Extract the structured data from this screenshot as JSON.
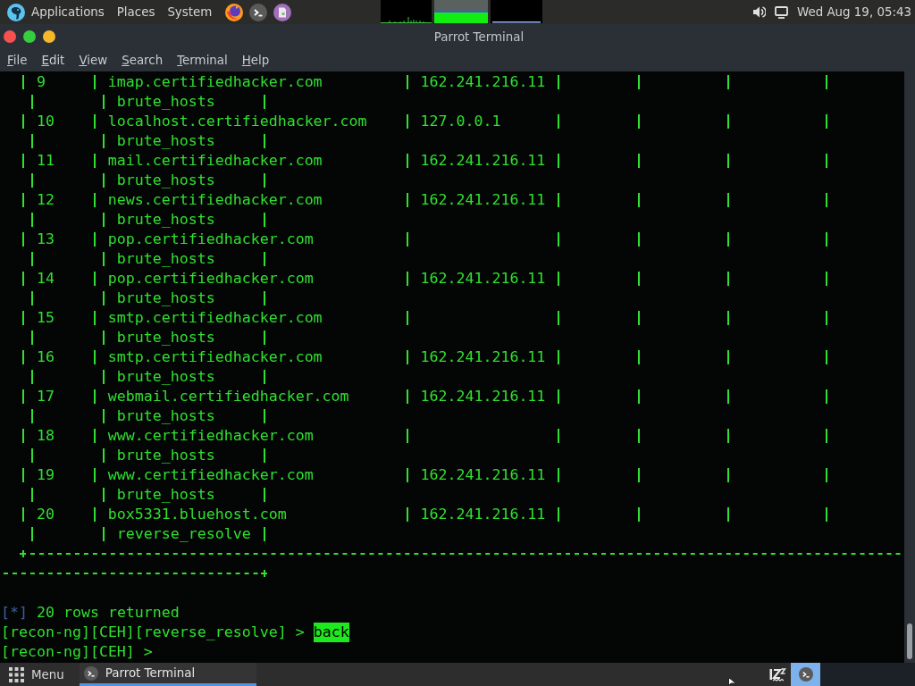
{
  "top_panel": {
    "menus": [
      "Applications",
      "Places",
      "System"
    ],
    "clock": "Wed Aug 19, 05:43"
  },
  "window": {
    "title": "Parrot Terminal",
    "menu": [
      "File",
      "Edit",
      "View",
      "Search",
      "Terminal",
      "Help"
    ]
  },
  "terminal": {
    "table": {
      "rows": [
        {
          "number": "9",
          "host": "imap.certifiedhacker.com",
          "ip": "162.241.216.11",
          "module": "brute_hosts"
        },
        {
          "number": "10",
          "host": "localhost.certifiedhacker.com",
          "ip": "127.0.0.1",
          "module": "brute_hosts"
        },
        {
          "number": "11",
          "host": "mail.certifiedhacker.com",
          "ip": "162.241.216.11",
          "module": "brute_hosts"
        },
        {
          "number": "12",
          "host": "news.certifiedhacker.com",
          "ip": "162.241.216.11",
          "module": "brute_hosts"
        },
        {
          "number": "13",
          "host": "pop.certifiedhacker.com",
          "module": "brute_hosts"
        },
        {
          "number": "14",
          "host": "pop.certifiedhacker.com",
          "ip": "162.241.216.11",
          "module": "brute_hosts"
        },
        {
          "number": "15",
          "host": "smtp.certifiedhacker.com",
          "module": "brute_hosts"
        },
        {
          "number": "16",
          "host": "smtp.certifiedhacker.com",
          "ip": "162.241.216.11",
          "module": "brute_hosts"
        },
        {
          "number": "17",
          "host": "webmail.certifiedhacker.com",
          "ip": "162.241.216.11",
          "module": "brute_hosts"
        },
        {
          "number": "18",
          "host": "www.certifiedhacker.com",
          "module": "brute_hosts"
        },
        {
          "number": "19",
          "host": "www.certifiedhacker.com",
          "ip": "162.241.216.11",
          "module": "brute_hosts"
        },
        {
          "number": "20",
          "host": "box5331.bluehost.com",
          "ip": "162.241.216.11",
          "module": "reverse_resolve"
        }
      ]
    },
    "status": {
      "marker": "[*]",
      "text": "20 rows returned"
    },
    "prompts": [
      {
        "prompt": "[recon-ng][CEH][reverse_resolve] >",
        "command": {
          "text": "back",
          "highlighted": true
        }
      },
      {
        "prompt": "[recon-ng][CEH] >"
      }
    ]
  },
  "taskbar": {
    "menu": "Menu",
    "tasks": [
      {
        "label": "Parrot Terminal",
        "selected": true
      }
    ],
    "workspaces": [
      {
        "selected": true
      }
    ]
  }
}
